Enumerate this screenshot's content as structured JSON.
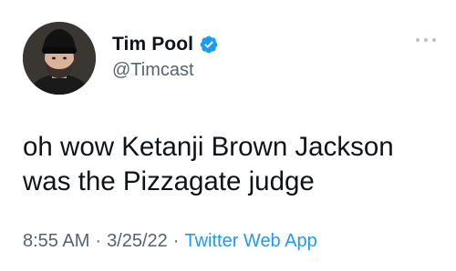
{
  "tweet": {
    "author": {
      "name": "Tim Pool",
      "handle": "@Timcast",
      "verified": true,
      "avatar": "avatar-man-beanie-beard"
    },
    "text": "oh wow Ketanji Brown Jackson\nwas the Pizzagate judge",
    "time": "8:55 AM",
    "date": "3/25/22",
    "separator": "·",
    "source": "Twitter Web App"
  },
  "icons": {
    "verified": "verified-badge-icon",
    "more": "more-options-icon"
  },
  "colors": {
    "text": "#0f1419",
    "secondary": "#536471",
    "accent": "#1d9bf0",
    "more_dots": "#b9c2ca"
  }
}
